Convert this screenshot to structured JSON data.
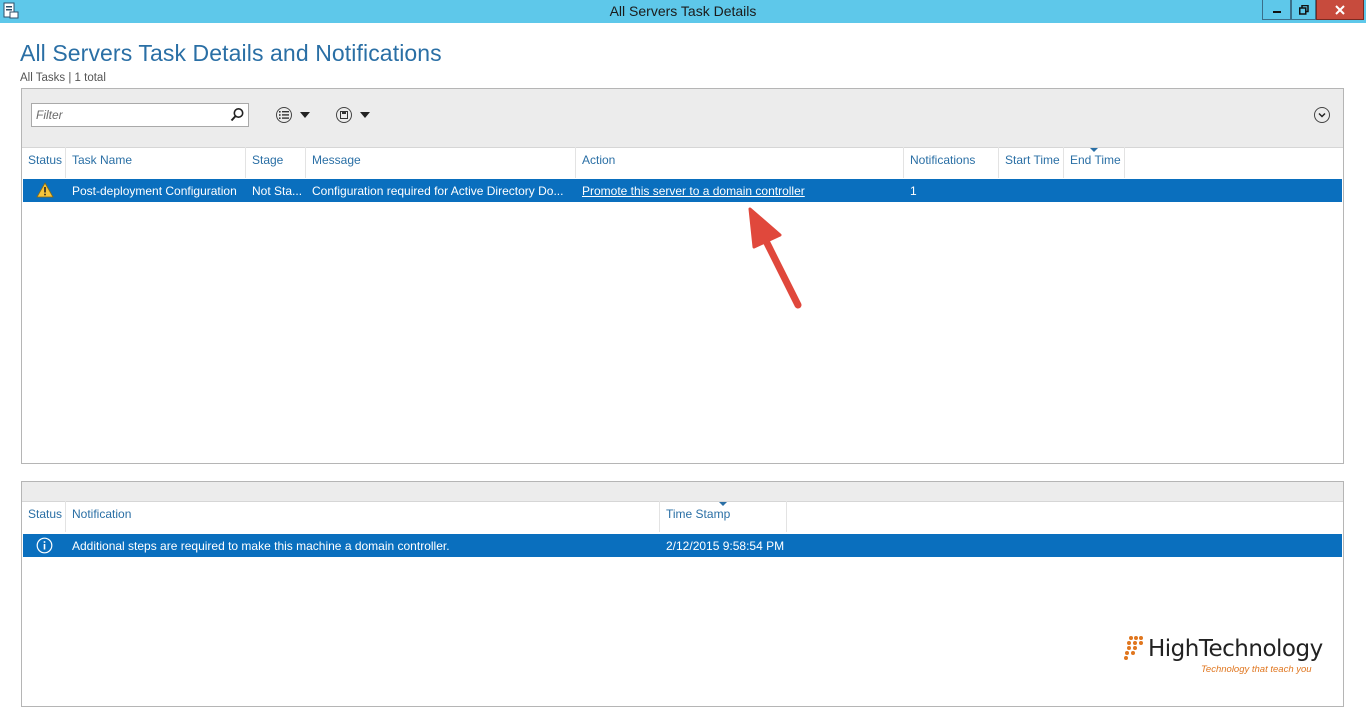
{
  "window": {
    "title": "All Servers Task Details"
  },
  "page": {
    "title": "All Servers Task Details and Notifications",
    "subtitle": "All Tasks | 1 total"
  },
  "tasks": {
    "filter_placeholder": "Filter",
    "columns": [
      "Status",
      "Task Name",
      "Stage",
      "Message",
      "Action",
      "Notifications",
      "Start Time",
      "End Time"
    ],
    "rows": [
      {
        "status_icon": "warning-icon",
        "task_name": "Post-deployment Configuration",
        "stage": "Not Sta...",
        "message": "Configuration required for Active Directory Do...",
        "action": "Promote this server to a domain controller",
        "notifications": "1",
        "start_time": "",
        "end_time": ""
      }
    ]
  },
  "notifications": {
    "columns": [
      "Status",
      "Notification",
      "Time Stamp"
    ],
    "rows": [
      {
        "status_icon": "info-icon",
        "notification": "Additional steps are required to make this machine a domain controller.",
        "time_stamp": "2/12/2015 9:58:54 PM"
      }
    ]
  },
  "watermark": {
    "brand": "HighTechnology",
    "tagline": "Technology that teach you"
  },
  "colors": {
    "titlebar": "#5ec8ea",
    "selection": "#0a6fbe",
    "header_text": "#2a6fa5",
    "close_button": "#c74b3d",
    "annotation_arrow": "#e0483c",
    "logo_accent": "#e0761f"
  }
}
